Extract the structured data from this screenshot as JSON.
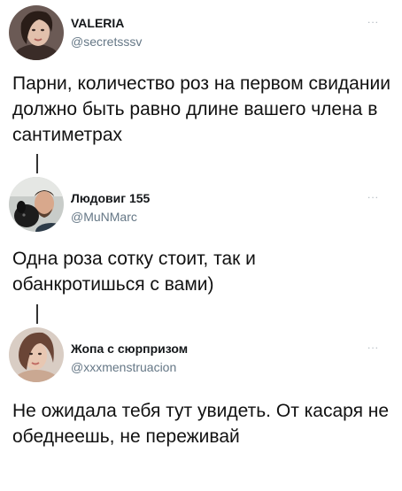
{
  "tweets": [
    {
      "name": "VALERIA",
      "handle": "@secretsssv",
      "more": "...",
      "text": "Парни, количество роз на первом свидании должно быть равно длине вашего члена в сантиметрах",
      "avatar": "avatar-photo-woman"
    },
    {
      "name": "Людовиг 155",
      "handle": "@MuNMarc",
      "more": "...",
      "text": "Одна роза сотку стоит, так и обанкротишься с вами)",
      "avatar": "avatar-photo-man-with-dog"
    },
    {
      "name": "Жопа с сюрпризом",
      "handle": "@xxxmenstruacion",
      "more": "...",
      "text": "Не ожидала тебя тут увидеть. От касаря не обеднеешь, не переживай",
      "avatar": "avatar-photo-woman"
    }
  ],
  "colors": {
    "text": "#111111",
    "handle": "#657786",
    "more": "#b0b8bf",
    "thread_line": "#333333"
  }
}
